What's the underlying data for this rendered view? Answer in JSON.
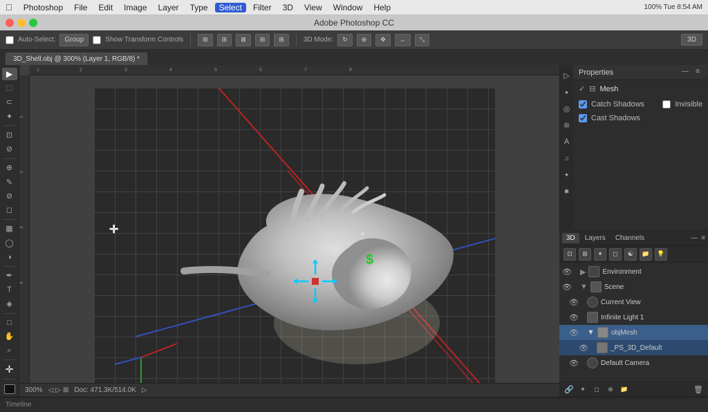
{
  "menubar": {
    "apple": "⌘",
    "items": [
      "Photoshop",
      "File",
      "Edit",
      "Image",
      "Layer",
      "Type",
      "Select",
      "Filter",
      "3D",
      "View",
      "Window",
      "Help"
    ],
    "active_item": "Select",
    "title": "Adobe Photoshop CC",
    "sys_right": "100%  Tue 8:54 AM"
  },
  "options_bar": {
    "auto_select_label": "Auto-Select:",
    "group_btn": "Group",
    "show_transform": "Show Transform Controls",
    "mode_label": "3D Mode:",
    "mode_btn": "3D",
    "icons": [
      "⊞",
      "⊞",
      "⊠",
      "⊞",
      "⊞"
    ]
  },
  "tab": {
    "label": "3D_Shell.obj @ 300% (Layer 1, RGB/8) *"
  },
  "tools": {
    "items": [
      "▶",
      "⊕",
      "✂",
      "⊘",
      "⊘",
      "⊘",
      "✎",
      "⊘",
      "⊘",
      "⊘",
      "T",
      "✏",
      "⊘",
      "⊘",
      "⊘",
      "⊘",
      "⊘",
      "⊘",
      "⊘",
      "⊘",
      "□"
    ]
  },
  "right_panel": {
    "properties_title": "Properties",
    "mesh_title": "Mesh",
    "catch_shadows": "Catch Shadows",
    "cast_shadows": "Cast Shadows",
    "invisible_label": "Invisible",
    "right_icons": [
      "▷",
      "◉",
      "⌖",
      "⊞",
      "A",
      "♪",
      "✦"
    ]
  },
  "layers_panel": {
    "3d_tab": "3D",
    "layers_tab": "Layers",
    "channels_tab": "Channels",
    "layers": [
      {
        "name": "Environment",
        "indent": 1,
        "type": "folder"
      },
      {
        "name": "Scene",
        "indent": 1,
        "type": "folder"
      },
      {
        "name": "Current View",
        "indent": 2,
        "type": "camera"
      },
      {
        "name": "Infinite Light 1",
        "indent": 2,
        "type": "light"
      },
      {
        "name": "objMesh",
        "indent": 2,
        "type": "mesh",
        "selected": true
      },
      {
        "name": "_PS_3D_Default",
        "indent": 3,
        "type": "material",
        "sub_selected": true
      },
      {
        "name": "Default Camera",
        "indent": 2,
        "type": "camera"
      }
    ]
  },
  "status_bar": {
    "zoom": "300%",
    "doc_info": "Doc: 471.3K/514.0K",
    "timeline_label": "Timeline"
  },
  "canvas": {
    "ruler_numbers_h": [
      "1",
      "2",
      "3",
      "4",
      "5",
      "6",
      "7",
      "8"
    ],
    "ruler_numbers_v": [
      "1",
      "2",
      "3",
      "4"
    ]
  }
}
